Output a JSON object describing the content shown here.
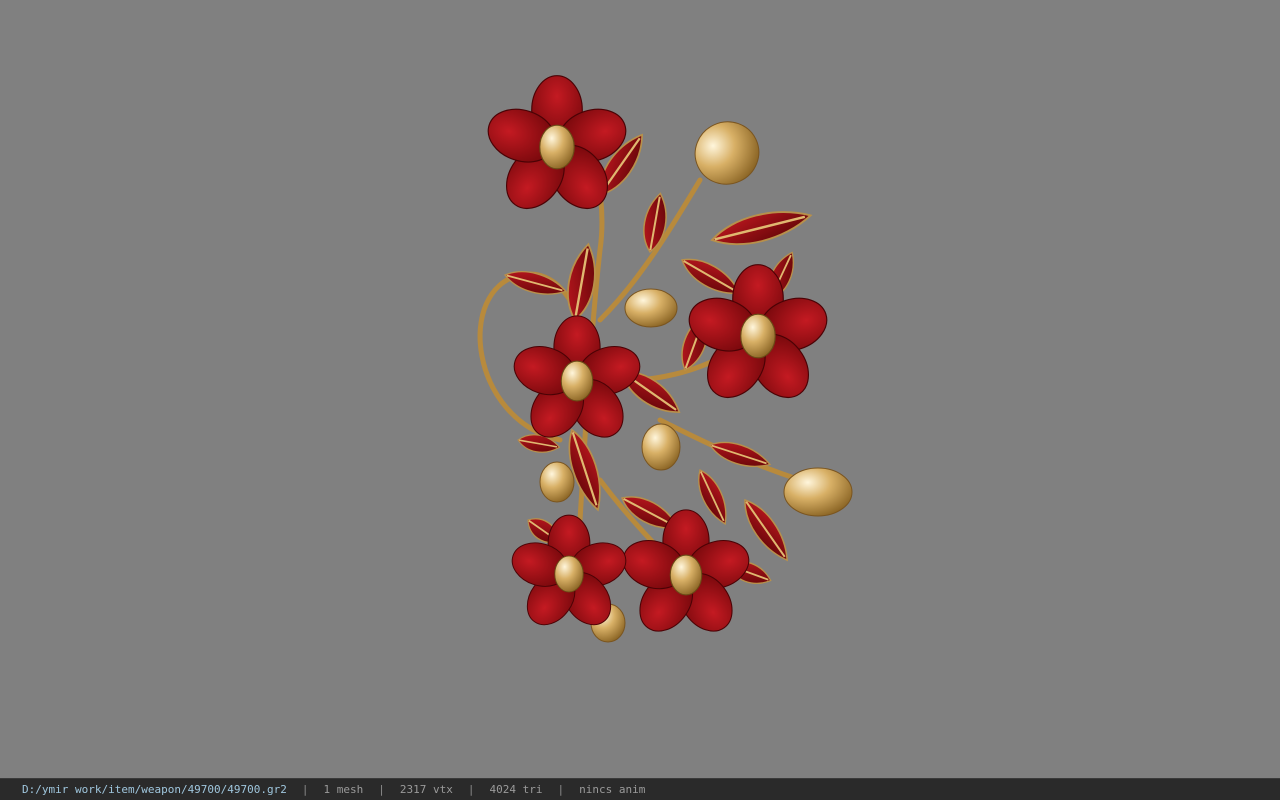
{
  "viewer": {
    "background_color": "#808080",
    "model": {
      "subject": "red-flower-ornament-icon",
      "petal_color": "#a00d14",
      "gold_color": "#c9a253"
    }
  },
  "status": {
    "path": "D:/ymir work/item/weapon/49700/49700.gr2",
    "separator": "|",
    "mesh": "1 mesh",
    "vertices": "2317 vtx",
    "triangles": "4024 tri",
    "animation": "nincs anim"
  }
}
